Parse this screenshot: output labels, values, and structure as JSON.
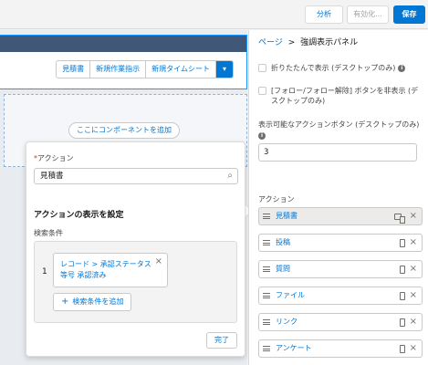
{
  "toolbar": {
    "analyze_label": "分析",
    "activate_label": "有効化...",
    "save_label": "保存"
  },
  "canvas": {
    "action_bar": [
      "見積書",
      "新規作業指示",
      "新規タイムシート"
    ],
    "add_component_label": "ここにコンポーネントを追加"
  },
  "popover": {
    "action_label": "アクション",
    "required_mark": "*",
    "action_value": "見積書",
    "visibility_heading": "アクションの表示を設定",
    "filter_label": "検索条件",
    "condition_number": "1",
    "condition_text": "レコード > 承認ステータス 等号 承認済み",
    "add_condition_label": "検索条件を追加",
    "done_label": "完了"
  },
  "panel": {
    "breadcrumb_link": "ページ",
    "breadcrumb_sep": ">",
    "breadcrumb_current": "強調表示パネル",
    "collapse_label": "折りたたんで表示 (デスクトップのみ)",
    "hide_follow_label": "[フォロー/フォロー解除] ボタンを非表示 (デスクトップのみ)",
    "visible_count_label": "表示可能なアクションボタン (デスクトップのみ)",
    "visible_count_value": "3",
    "actions_label": "アクション",
    "actions": [
      "見積書",
      "投稿",
      "質問",
      "ファイル",
      "リンク",
      "アンケート"
    ]
  },
  "colors": {
    "brand": "#0176d3",
    "border": "#c9c9c9"
  }
}
